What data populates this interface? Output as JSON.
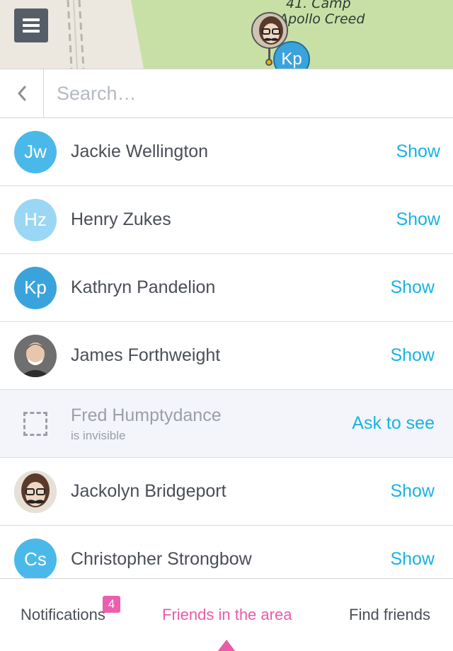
{
  "map": {
    "place_label_line1": "41. Camp",
    "place_label_line2": "Apollo Creed",
    "marker_badge": "Kp",
    "colors": {
      "land": "#ece8e0",
      "park": "#c8e0a6",
      "accent": "#3ba3dc"
    }
  },
  "toolbar": {
    "menu_icon": "hamburger-menu-icon",
    "back_icon": "chevron-left-icon"
  },
  "search": {
    "placeholder": "Search…",
    "value": ""
  },
  "friends": [
    {
      "initials": "Jw",
      "name": "Jackie Wellington",
      "action": "Show",
      "avatar_color": "#4ab9ea"
    },
    {
      "initials": "Hz",
      "name": "Henry Zukes",
      "action": "Show",
      "avatar_color": "#9ad7f5"
    },
    {
      "initials": "Kp",
      "name": "Kathryn Pandelion",
      "action": "Show",
      "avatar_color": "#3ba3dc"
    },
    {
      "initials": "",
      "name": "James Forthweight",
      "action": "Show",
      "avatar": "photo"
    },
    {
      "initials": "",
      "name": "Fred Humptydance",
      "status": "is invisible",
      "action": "Ask to see",
      "avatar": "placeholder-icon"
    },
    {
      "initials": "",
      "name": "Jackolyn Bridgeport",
      "action": "Show",
      "avatar": "photo"
    },
    {
      "initials": "Cs",
      "name": "Christopher Strongbow",
      "action": "Show",
      "avatar_color": "#4ab9ea"
    }
  ],
  "tabs": {
    "notifications": "Notifications",
    "notifications_badge": "4",
    "friends_in_area": "Friends in the area",
    "find_friends": "Find friends",
    "active": "friends_in_area",
    "accent_color": "#ea5ba9",
    "link_color": "#18b3e3"
  }
}
